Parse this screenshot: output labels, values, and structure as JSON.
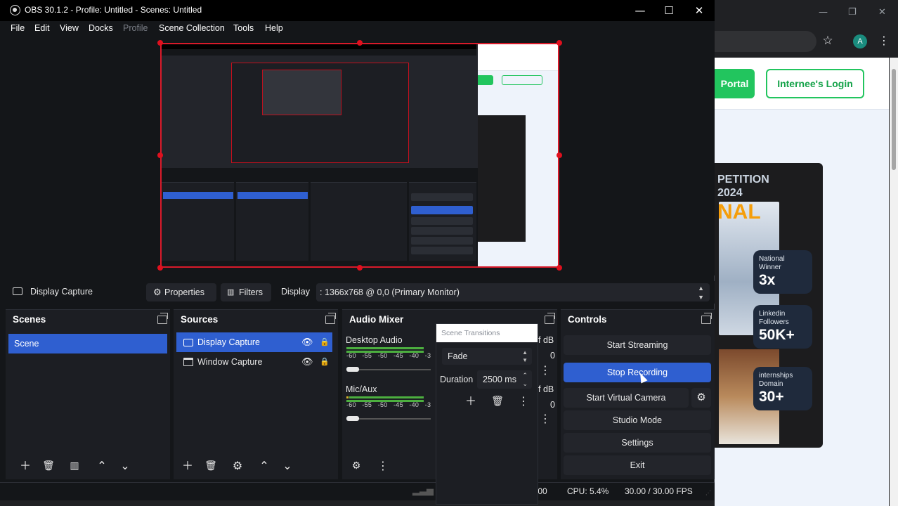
{
  "window": {
    "title": "OBS 30.1.2 - Profile: Untitled - Scenes: Untitled"
  },
  "menu": [
    "File",
    "Edit",
    "View",
    "Docks",
    "Profile",
    "Scene Collection",
    "Tools",
    "Help"
  ],
  "browser": {
    "portal_label": "Portal",
    "internee_login_label": "Internee's Login",
    "avatar_letter": "A",
    "promo": {
      "heading_line1": "PETITION",
      "heading_line2": "2024",
      "heading_line3": "NAL",
      "stats": [
        {
          "label": "National Winner",
          "value": "3x"
        },
        {
          "label": "Linkedin Followers",
          "value": "50K+"
        },
        {
          "label": "internships Domain",
          "value": "30+"
        }
      ]
    }
  },
  "source_toolbar": {
    "source_name": "Display Capture",
    "properties_label": "Properties",
    "filters_label": "Filters",
    "display_label": "Display",
    "display_value": ": 1366x768 @ 0,0 (Primary Monitor)"
  },
  "scenes": {
    "title": "Scenes",
    "items": [
      "Scene"
    ]
  },
  "sources": {
    "title": "Sources",
    "items": [
      "Display Capture",
      "Window Capture"
    ]
  },
  "mixer": {
    "title": "Audio Mixer",
    "channels": [
      {
        "name": "Desktop Audio",
        "db": "f dB",
        "level": "0"
      },
      {
        "name": "Mic/Aux",
        "db": "f dB",
        "level": "0"
      }
    ],
    "scale": [
      "-60",
      "-55",
      "-50",
      "-45",
      "-40",
      "-3"
    ]
  },
  "transitions": {
    "title": "Scene Transitions",
    "selected": "Fade",
    "duration_label": "Duration",
    "duration_value": "2500 ms"
  },
  "controls": {
    "title": "Controls",
    "buttons": [
      "Start Streaming",
      "Stop Recording",
      "Start Virtual Camera",
      "Studio Mode",
      "Settings",
      "Exit"
    ]
  },
  "status": {
    "time_partial": ":00",
    "cpu": "CPU: 5.4%",
    "fps": "30.00 / 30.00 FPS"
  },
  "colors": {
    "accent_blue": "#2f5fd0",
    "selection_red": "#d91a2a",
    "brand_green": "#22c55e"
  }
}
